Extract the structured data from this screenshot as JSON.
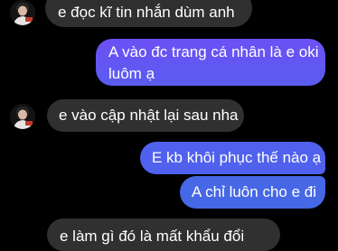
{
  "conversation": {
    "messages": [
      {
        "direction": "incoming",
        "text": "e đọc kĩ tin nhắn dùm anh"
      },
      {
        "direction": "outgoing",
        "lines": [
          "A vào đc trang cá nhân là e oki",
          "luôm ạ"
        ]
      },
      {
        "direction": "incoming",
        "text": "e vào cập nhật lại sau nha"
      },
      {
        "direction": "outgoing",
        "text": "E kb khôi phục thế nào ạ"
      },
      {
        "direction": "outgoing",
        "text": "A chỉ luôn cho e đi"
      },
      {
        "direction": "incoming",
        "text": "e làm gì đó là mất khẩu đổi"
      }
    ]
  },
  "colors": {
    "background": "#000000",
    "incoming_bubble": "#303030",
    "outgoing_bubble_top": "#6b52f2",
    "outgoing_bubble_bottom": "#4a63e8",
    "text": "#ffffff"
  },
  "icons": {
    "avatar": "user-avatar-photo"
  }
}
